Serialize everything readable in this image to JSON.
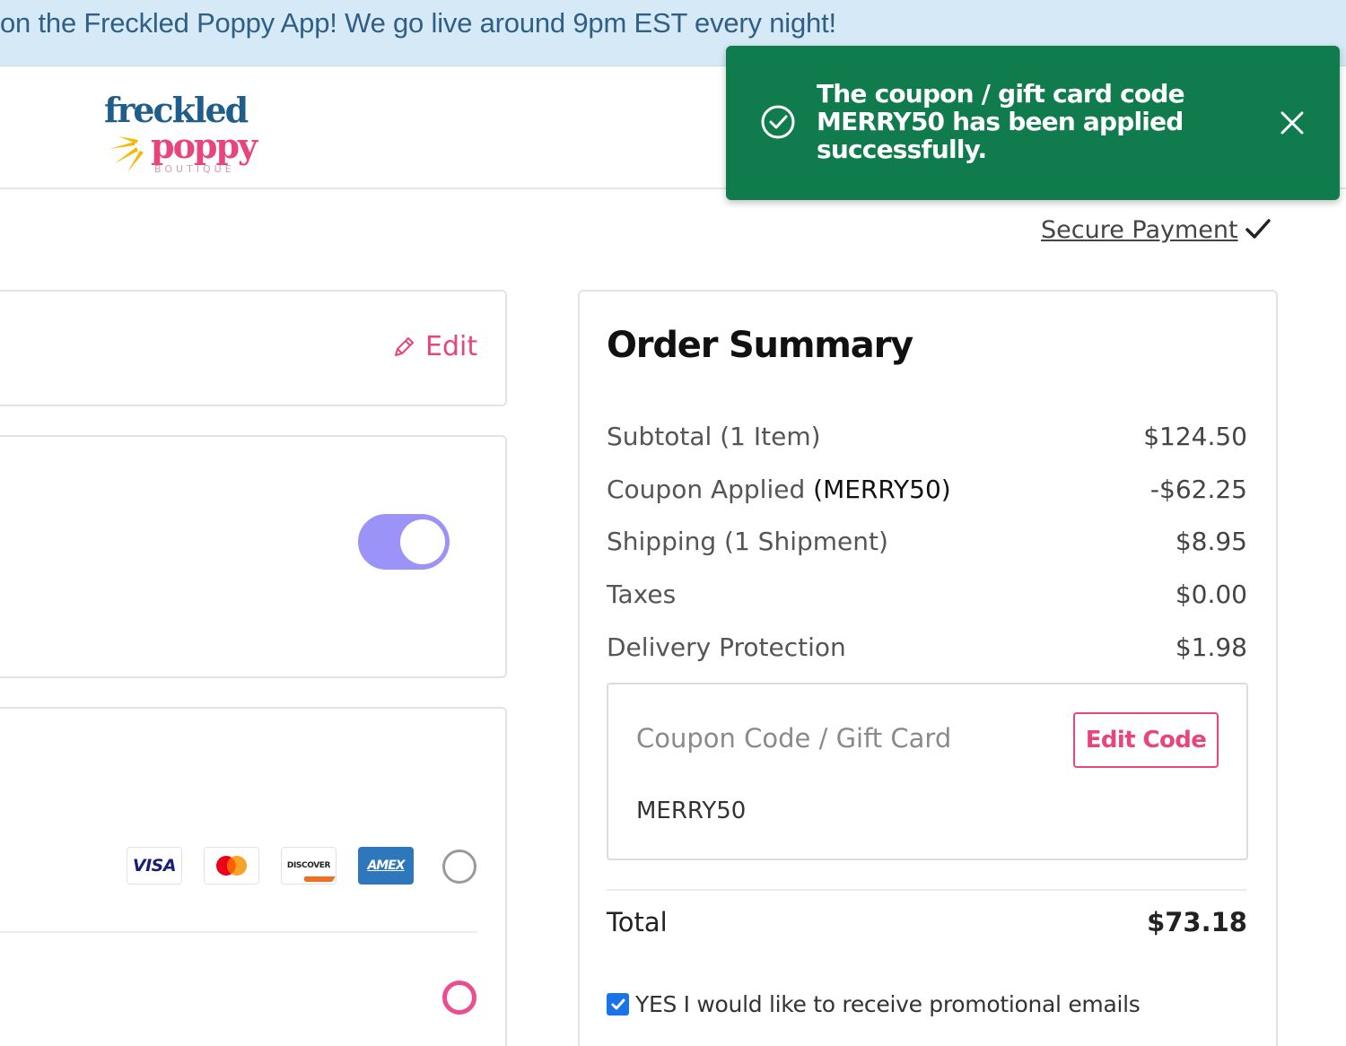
{
  "banner": {
    "text": "on the Freckled Poppy App! We go live around 9pm EST every night!"
  },
  "logo": {
    "line1": "freckled",
    "line2": "poppy",
    "tagline": "BOUTIQUE"
  },
  "toast": {
    "message": "The coupon / gift card code MERRY50 has been applied successfully.",
    "icon": "check-circle-icon",
    "close_icon": "close-icon",
    "background": "#107c4d"
  },
  "secure_payment": {
    "label": "Secure Payment ",
    "icon": "checkmark-icon"
  },
  "left_panel": {
    "edit_label": "Edit",
    "toggle_on": true,
    "payment_icons": {
      "visa": "VISA",
      "mastercard": "mastercard-icon",
      "discover": "DISCOVER",
      "amex": "AMEX"
    }
  },
  "order_summary": {
    "title": "Order Summary",
    "rows": [
      {
        "label": "Subtotal (1 Item)",
        "value": "$124.50"
      },
      {
        "label": "Coupon Applied ",
        "code": "(MERRY50)",
        "value": "-$62.25"
      },
      {
        "label": "Shipping (1 Shipment)",
        "value": "$8.95"
      },
      {
        "label": "Taxes",
        "value": "$0.00"
      },
      {
        "label": "Delivery Protection",
        "value": "$1.98"
      }
    ],
    "coupon": {
      "label": "Coupon Code / Gift Card",
      "button": "Edit Code",
      "value": "MERRY50"
    },
    "total": {
      "label": "Total",
      "value": "$73.18"
    },
    "promo": {
      "label": "YES I would like to receive promotional emails",
      "checked": true
    }
  },
  "colors": {
    "accent_pink": "#e8457d",
    "toggle_purple": "#9b93f7",
    "banner_bg": "#d6e9f6",
    "checkbox_blue": "#1a73e8"
  }
}
